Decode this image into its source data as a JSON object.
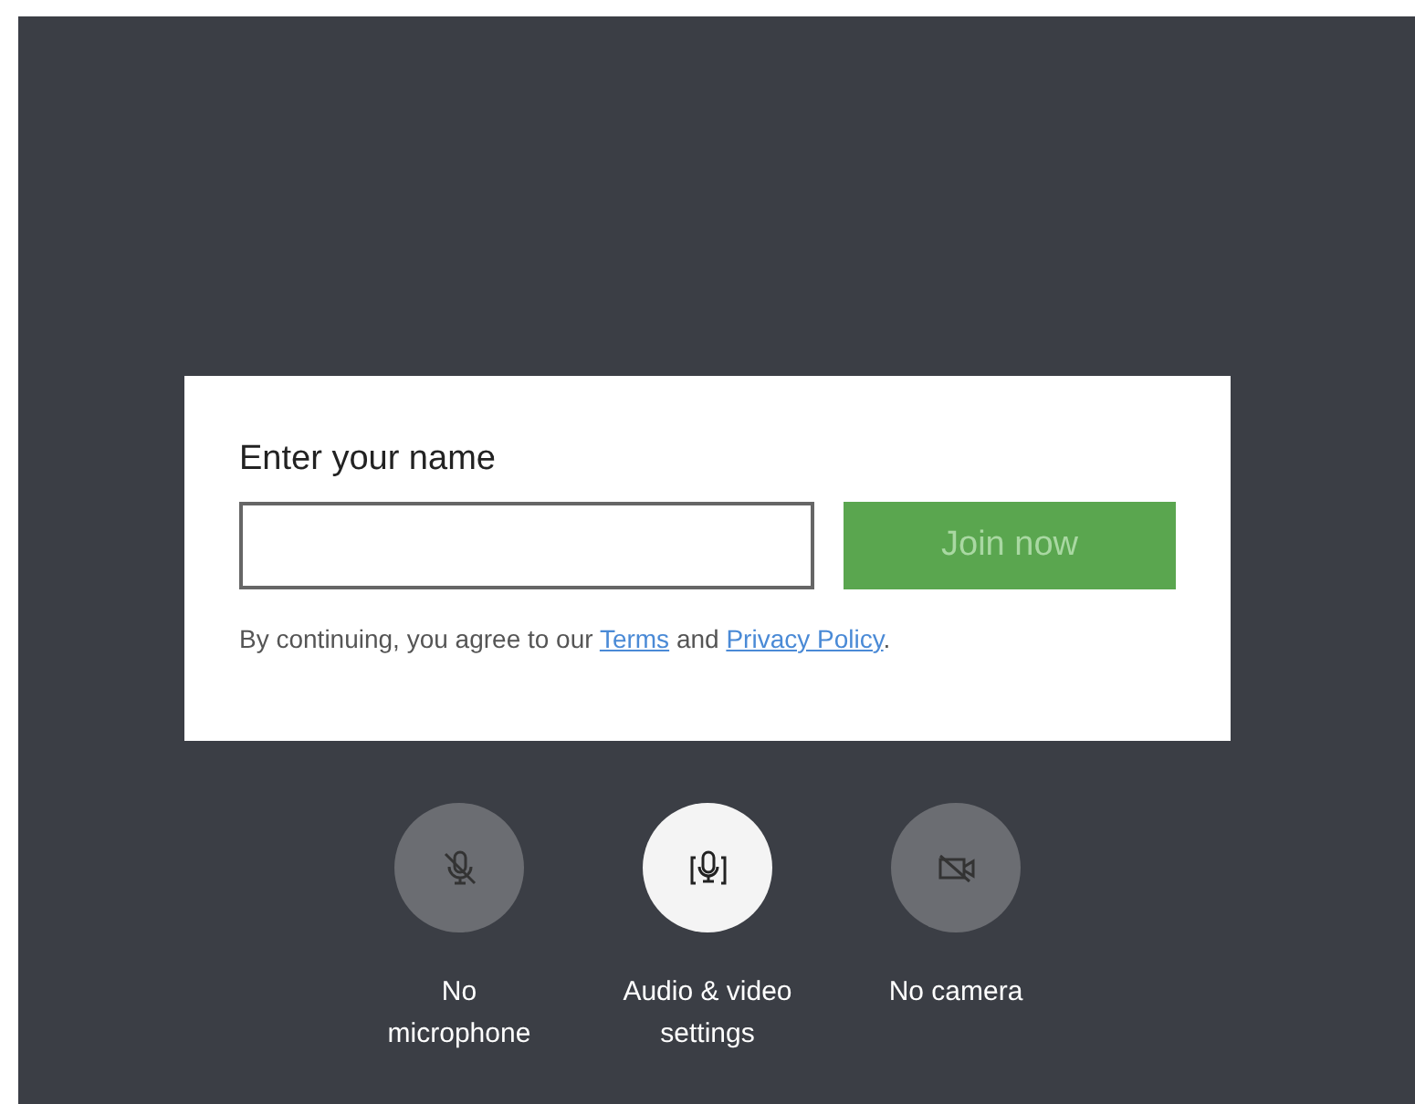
{
  "prompt": {
    "label": "Enter your name",
    "join_button": {
      "label": "Join now",
      "disabled": true
    },
    "consent": {
      "before": "By continuing, you agree to our ",
      "terms_link": "Terms",
      "middle": " and ",
      "privacy_link": "Privacy Policy",
      "after": "."
    }
  },
  "device_controls": [
    {
      "kind": "microphone",
      "label": "No microphone",
      "active": false
    },
    {
      "kind": "settings",
      "label": "Audio & video settings",
      "active": true
    },
    {
      "kind": "camera",
      "label": "No camera",
      "active": false
    }
  ]
}
